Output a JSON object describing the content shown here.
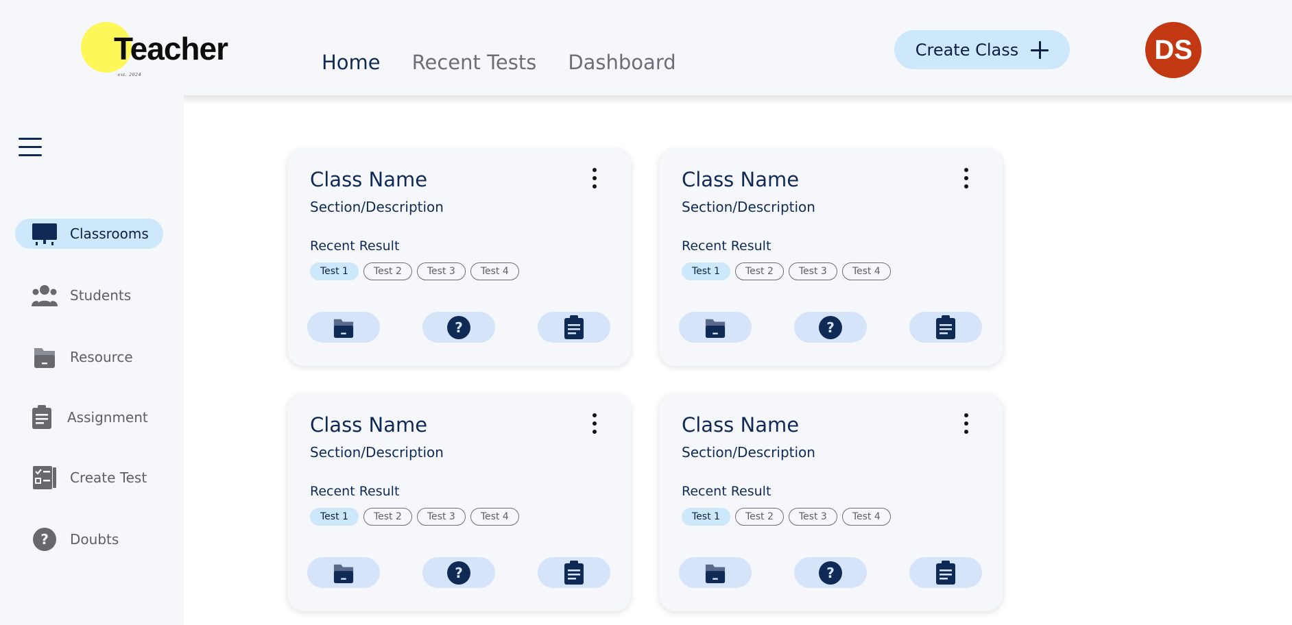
{
  "logo": {
    "text": "Teacher",
    "tagline": "est. 2024"
  },
  "nav": {
    "items": [
      {
        "label": "Home",
        "active": true
      },
      {
        "label": "Recent Tests",
        "active": false
      },
      {
        "label": "Dashboard",
        "active": false
      }
    ]
  },
  "header": {
    "create_class_label": "Create Class",
    "avatar_initials": "DS"
  },
  "sidebar": {
    "items": [
      {
        "label": "Classrooms",
        "icon": "classroom-board-icon",
        "active": true
      },
      {
        "label": "Students",
        "icon": "students-group-icon",
        "active": false
      },
      {
        "label": "Resource",
        "icon": "folder-icon",
        "active": false
      },
      {
        "label": "Assignment",
        "icon": "clipboard-icon",
        "active": false
      },
      {
        "label": "Create Test",
        "icon": "checklist-icon",
        "active": false
      },
      {
        "label": "Doubts",
        "icon": "question-icon",
        "active": false
      }
    ]
  },
  "cards": [
    {
      "title": "Class Name",
      "subtitle": "Section/Description",
      "result_label": "Recent Result",
      "tests": [
        "Test 1",
        "Test 2",
        "Test 3",
        "Test 4"
      ],
      "active_test": "Test 1"
    },
    {
      "title": "Class Name",
      "subtitle": "Section/Description",
      "result_label": "Recent Result",
      "tests": [
        "Test 1",
        "Test 2",
        "Test 3",
        "Test 4"
      ],
      "active_test": "Test 1"
    },
    {
      "title": "Class Name",
      "subtitle": "Section/Description",
      "result_label": "Recent Result",
      "tests": [
        "Test 1",
        "Test 2",
        "Test 3",
        "Test 4"
      ],
      "active_test": "Test 1"
    },
    {
      "title": "Class Name",
      "subtitle": "Section/Description",
      "result_label": "Recent Result",
      "tests": [
        "Test 1",
        "Test 2",
        "Test 3",
        "Test 4"
      ],
      "active_test": "Test 1"
    }
  ],
  "card_actions": [
    "folder-icon",
    "question-icon",
    "clipboard-icon"
  ],
  "colors": {
    "accent_light": "#cde7fb",
    "navy": "#102a56",
    "avatar": "#c23812",
    "logo_sun": "#fdf75a",
    "panel": "#f6f7fb"
  }
}
